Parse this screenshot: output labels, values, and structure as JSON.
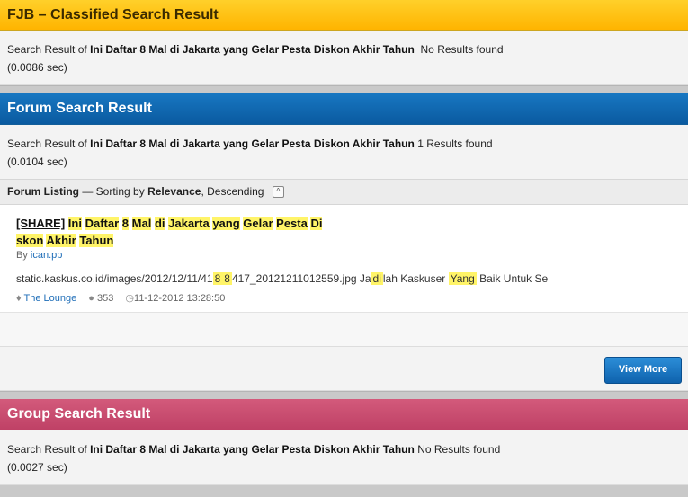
{
  "fjb": {
    "header": "FJB – Classified Search Result",
    "prefix": "Search Result of",
    "query": "Ini Daftar 8 Mal di Jakarta yang Gelar Pesta Diskon Akhir Tahun",
    "result": "No Results found",
    "time": "(0.0086 sec)"
  },
  "forum": {
    "header": "Forum Search Result",
    "prefix": "Search Result of",
    "query": "Ini Daftar 8 Mal di Jakarta yang Gelar Pesta Diskon Akhir Tahun",
    "result": "1 Results found",
    "time": "(0.0104 sec)",
    "listing": {
      "label": "Forum Listing",
      "sorting_prefix": "— Sorting by",
      "sort_field": "Relevance",
      "sort_order": ", Descending",
      "toggle": "^"
    },
    "item": {
      "tag": "[SHARE]",
      "title_words": [
        "Ini",
        "Daftar",
        "8",
        "Mal",
        "di",
        "Jakarta",
        "yang",
        "Gelar",
        "Pesta",
        "Di"
      ],
      "title_words2": [
        "skon",
        "Akhir",
        "Tahun"
      ],
      "by_prefix": "By",
      "author": "ican.pp",
      "snippet_a": "static.kaskus.co.id/images/2012/12/11/41",
      "snippet_hl1": "8",
      "snippet_hl2": "8",
      "snippet_b": "417_20121211012559.jpg Ja",
      "snippet_hl3": "di",
      "snippet_c": "lah Kaskuser",
      "snippet_hl4": "Yang",
      "snippet_d": "Baik Untuk Se",
      "forum_name": "The Lounge",
      "replies": "353",
      "date": "11-12-2012 13:28:50"
    },
    "view_more": "View More"
  },
  "group": {
    "header": "Group Search Result",
    "prefix": "Search Result of",
    "query": "Ini Daftar 8 Mal di Jakarta yang Gelar Pesta Diskon Akhir Tahun",
    "result": "No Results found",
    "time": "(0.0027 sec)"
  }
}
